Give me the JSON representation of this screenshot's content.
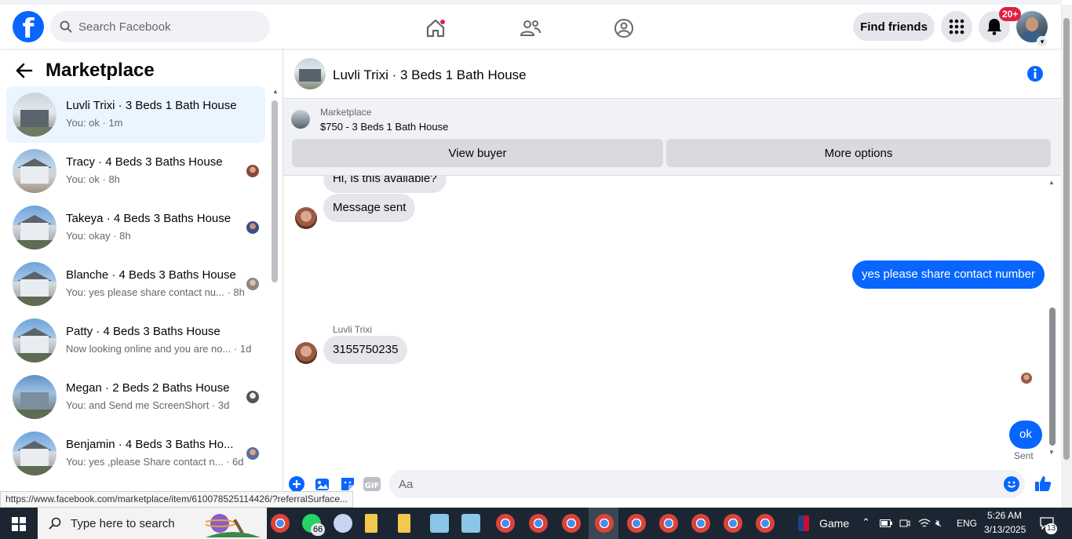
{
  "topbar": {
    "search_placeholder": "Search Facebook",
    "find_friends_label": "Find friends",
    "notifications_badge": "20+",
    "brand_color": "#0866ff"
  },
  "sidebar": {
    "title": "Marketplace",
    "conversations": [
      {
        "name": "Luvli Trixi · 3 Beds 1 Bath House",
        "preview": "You: ok · 1m",
        "active": true
      },
      {
        "name": "Tracy · 4 Beds 3 Baths House",
        "preview": "You: ok · 8h"
      },
      {
        "name": "Takeya · 4 Beds 3 Baths House",
        "preview": "You: okay · 8h"
      },
      {
        "name": "Blanche · 4 Beds 3 Baths House",
        "preview": "You: yes please share contact nu... · 8h"
      },
      {
        "name": "Patty · 4 Beds 3 Baths House",
        "preview": "Now looking online and you are no... · 1d"
      },
      {
        "name": "Megan · 2 Beds 2 Baths House",
        "preview": "You: and Send me ScreenShort · 3d"
      },
      {
        "name": "Benjamin · 4 Beds 3 Baths Ho...",
        "preview": "You: yes ,please Share contact n... · 6d"
      }
    ]
  },
  "chat": {
    "title": "Luvli Trixi · 3 Beds 1 Bath House",
    "listing_source": "Marketplace",
    "listing_price": "$750 - 3 Beds 1 Bath House",
    "view_buyer_label": "View buyer",
    "more_options_label": "More options",
    "messages": {
      "m1": "Hi, is this available?",
      "m2": "Message sent",
      "m3": "yes please share contact number",
      "sender": "Luvli Trixi",
      "m4": "3155750235",
      "m5": "ok",
      "status": "Sent"
    },
    "composer_placeholder": "Aa"
  },
  "status_url": "https://www.facebook.com/marketplace/item/610078525114426/?referralSurface...",
  "taskbar": {
    "search_placeholder": "Type here to search",
    "whatsapp_badge": "66",
    "game_label": "Game",
    "language": "ENG",
    "time": "5:26 AM",
    "date": "3/13/2025",
    "notification_count": "13"
  }
}
